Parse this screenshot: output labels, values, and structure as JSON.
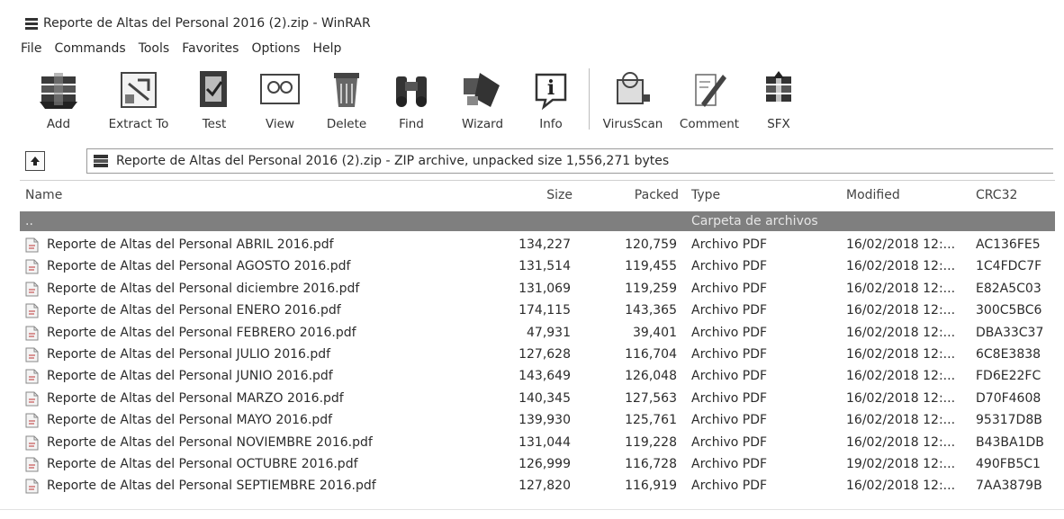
{
  "window": {
    "title": "Reporte de Altas del Personal  2016 (2).zip - WinRAR"
  },
  "menu": [
    "File",
    "Commands",
    "Tools",
    "Favorites",
    "Options",
    "Help"
  ],
  "toolbar": [
    {
      "label": "Add",
      "icon": "add-archive-icon"
    },
    {
      "label": "Extract To",
      "icon": "extract-icon"
    },
    {
      "label": "Test",
      "icon": "test-icon"
    },
    {
      "label": "View",
      "icon": "view-icon"
    },
    {
      "label": "Delete",
      "icon": "delete-icon"
    },
    {
      "label": "Find",
      "icon": "binoculars-icon"
    },
    {
      "label": "Wizard",
      "icon": "wizard-icon"
    },
    {
      "label": "Info",
      "icon": "info-icon"
    },
    {
      "label": "VirusScan",
      "icon": "virusscan-icon"
    },
    {
      "label": "Comment",
      "icon": "comment-icon"
    },
    {
      "label": "SFX",
      "icon": "sfx-icon"
    }
  ],
  "address": {
    "path": "Reporte de Altas del Personal  2016 (2).zip - ZIP archive, unpacked size 1,556,271 bytes"
  },
  "columns": {
    "name": "Name",
    "size": "Size",
    "packed": "Packed",
    "type": "Type",
    "modified": "Modified",
    "crc": "CRC32"
  },
  "parent_row": {
    "name": "..",
    "type": "Carpeta de archivos"
  },
  "files": [
    {
      "name": "Reporte de Altas del Personal ABRIL 2016.pdf",
      "size": "134,227",
      "packed": "120,759",
      "type": "Archivo PDF",
      "modified": "16/02/2018 12:...",
      "crc": "AC136FE5"
    },
    {
      "name": "Reporte de Altas del Personal AGOSTO 2016.pdf",
      "size": "131,514",
      "packed": "119,455",
      "type": "Archivo PDF",
      "modified": "16/02/2018 12:...",
      "crc": "1C4FDC7F"
    },
    {
      "name": "Reporte de Altas del Personal diciembre 2016.pdf",
      "size": "131,069",
      "packed": "119,259",
      "type": "Archivo PDF",
      "modified": "16/02/2018 12:...",
      "crc": "E82A5C03"
    },
    {
      "name": "Reporte de Altas del Personal ENERO 2016.pdf",
      "size": "174,115",
      "packed": "143,365",
      "type": "Archivo PDF",
      "modified": "16/02/2018 12:...",
      "crc": "300C5BC6"
    },
    {
      "name": "Reporte de Altas del Personal FEBRERO 2016.pdf",
      "size": "47,931",
      "packed": "39,401",
      "type": "Archivo PDF",
      "modified": "16/02/2018 12:...",
      "crc": "DBA33C37"
    },
    {
      "name": "Reporte de Altas del Personal JULIO 2016.pdf",
      "size": "127,628",
      "packed": "116,704",
      "type": "Archivo PDF",
      "modified": "16/02/2018 12:...",
      "crc": "6C8E3838"
    },
    {
      "name": "Reporte de Altas del Personal JUNIO 2016.pdf",
      "size": "143,649",
      "packed": "126,048",
      "type": "Archivo PDF",
      "modified": "16/02/2018 12:...",
      "crc": "FD6E22FC"
    },
    {
      "name": "Reporte de Altas del Personal MARZO 2016.pdf",
      "size": "140,345",
      "packed": "127,563",
      "type": "Archivo PDF",
      "modified": "16/02/2018 12:...",
      "crc": "D70F4608"
    },
    {
      "name": "Reporte de Altas del Personal MAYO 2016.pdf",
      "size": "139,930",
      "packed": "125,761",
      "type": "Archivo PDF",
      "modified": "16/02/2018 12:...",
      "crc": "95317D8B"
    },
    {
      "name": "Reporte de Altas del Personal NOVIEMBRE 2016.pdf",
      "size": "131,044",
      "packed": "119,228",
      "type": "Archivo PDF",
      "modified": "16/02/2018 12:...",
      "crc": "B43BA1DB"
    },
    {
      "name": "Reporte de Altas del Personal OCTUBRE 2016.pdf",
      "size": "126,999",
      "packed": "116,728",
      "type": "Archivo PDF",
      "modified": "19/02/2018 12:...",
      "crc": "490FB5C1"
    },
    {
      "name": "Reporte de Altas del Personal SEPTIEMBRE 2016.pdf",
      "size": "127,820",
      "packed": "116,919",
      "type": "Archivo PDF",
      "modified": "16/02/2018 12:...",
      "crc": "7AA3879B"
    }
  ],
  "colors": {
    "parent_row_bg": "#7f7f7f",
    "parent_row_text": "#e6e6e6"
  }
}
